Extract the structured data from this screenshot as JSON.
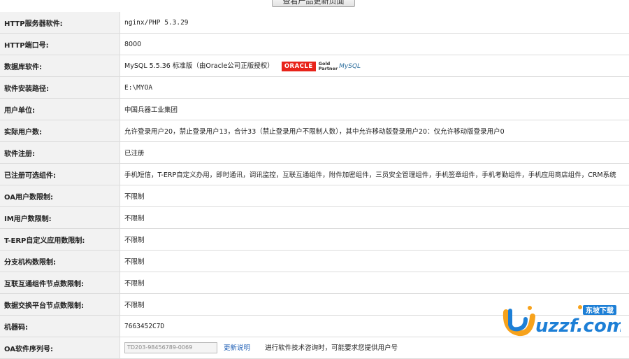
{
  "top_button": "查看产品更新页面",
  "rows": [
    {
      "label": "HTTP服务器软件:",
      "value": "nginx/PHP 5.3.29"
    },
    {
      "label": "HTTP端口号:",
      "value": "8000"
    },
    {
      "label": "数据库软件:",
      "value": "MySQL 5.5.36 标准版（由Oracle公司正版授权）"
    },
    {
      "label": "软件安装路径:",
      "value": "E:\\MYOA"
    },
    {
      "label": "用户单位:",
      "value": "中国兵器工业集团"
    },
    {
      "label": "实际用户数:",
      "value": "允许登录用户20，禁止登录用户13，合计33（禁止登录用户不限制人数），其中允许移动版登录用户20：仅允许移动版登录用户0"
    },
    {
      "label": "软件注册:",
      "value": "已注册"
    },
    {
      "label": "已注册可选组件:",
      "value": "手机短信，T-ERP自定义办用，即时通讯，调讯监控，互联互通组件，附件加密组件，三员安全管理组件，手机签章组件，手机考勤组件，手机应用商店组件，CRM系统"
    },
    {
      "label": "OA用户数限制:",
      "value": "不限制"
    },
    {
      "label": "IM用户数限制:",
      "value": "不限制"
    },
    {
      "label": "T-ERP自定义应用数限制:",
      "value": "不限制"
    },
    {
      "label": "分支机构数限制:",
      "value": "不限制"
    },
    {
      "label": "互联互通组件节点数限制:",
      "value": "不限制"
    },
    {
      "label": "数据交换平台节点数限制:",
      "value": "不限制"
    },
    {
      "label": "机器码:",
      "value": "7663452C7D"
    },
    {
      "label": "OA软件序列号:",
      "value": "TD203-98456789-0069",
      "link": "更新说明",
      "note": "进行软件技术咨询时，可能要求您提供用户号"
    }
  ],
  "logos": {
    "oracle": "ORACLE",
    "gold": "Gold",
    "partner": "Partner",
    "mysql": "MySQL"
  },
  "watermark": {
    "site": "uzzf.com",
    "brand": "东坡下载"
  },
  "colors": {
    "label_bg": "#f2f2f2",
    "border": "#dcdcdc",
    "oracle_red": "#e8231a",
    "wm_blue": "#1d7fd6",
    "wm_orange": "#f7a21b"
  }
}
